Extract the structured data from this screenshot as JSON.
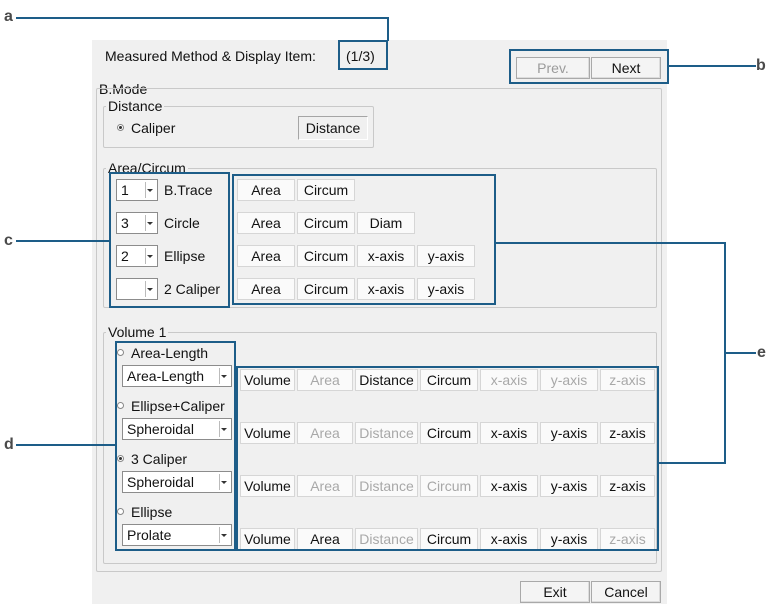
{
  "dialog": {
    "title": "Measured Method & Display Item:",
    "page_indicator": "(1/3)",
    "prev_label": "Prev.",
    "next_label": "Next",
    "mode_label": "B.Mode",
    "exit_label": "Exit",
    "cancel_label": "Cancel"
  },
  "distance": {
    "group_label": "Distance",
    "option_label": "Caliper",
    "display_item": "Distance"
  },
  "area_circum": {
    "group_label": "Area/Circum",
    "rows": [
      {
        "count": "1",
        "method": "B.Trace",
        "items": [
          "Area",
          "Circum"
        ]
      },
      {
        "count": "3",
        "method": "Circle",
        "items": [
          "Area",
          "Circum",
          "Diam"
        ]
      },
      {
        "count": "2",
        "method": "Ellipse",
        "items": [
          "Area",
          "Circum",
          "x-axis",
          "y-axis"
        ]
      },
      {
        "count": "",
        "method": "2 Caliper",
        "items": [
          "Area",
          "Circum",
          "x-axis",
          "y-axis"
        ]
      }
    ]
  },
  "volume": {
    "group_label": "Volume 1",
    "column_headers": [
      "Volume",
      "Area",
      "Distance",
      "Circum",
      "x-axis",
      "y-axis",
      "z-axis"
    ],
    "rows": [
      {
        "method": "Area-Length",
        "selected": false,
        "formula": "Area-Length",
        "enabled": [
          true,
          false,
          true,
          true,
          false,
          false,
          false
        ]
      },
      {
        "method": "Ellipse+Caliper",
        "selected": false,
        "formula": "Spheroidal",
        "enabled": [
          true,
          false,
          false,
          true,
          true,
          true,
          true
        ]
      },
      {
        "method": "3 Caliper",
        "selected": true,
        "formula": "Spheroidal",
        "enabled": [
          true,
          false,
          false,
          false,
          true,
          true,
          true
        ]
      },
      {
        "method": "Ellipse",
        "selected": false,
        "formula": "Prolate",
        "enabled": [
          true,
          true,
          false,
          true,
          true,
          true,
          false
        ]
      }
    ]
  },
  "callouts": {
    "a": "a",
    "b": "b",
    "c": "c",
    "d": "d",
    "e": "e"
  },
  "colors": {
    "callout": "#1d5d88",
    "dialog_bg": "#f0f0f0",
    "disabled_text": "#a8a8a8"
  }
}
